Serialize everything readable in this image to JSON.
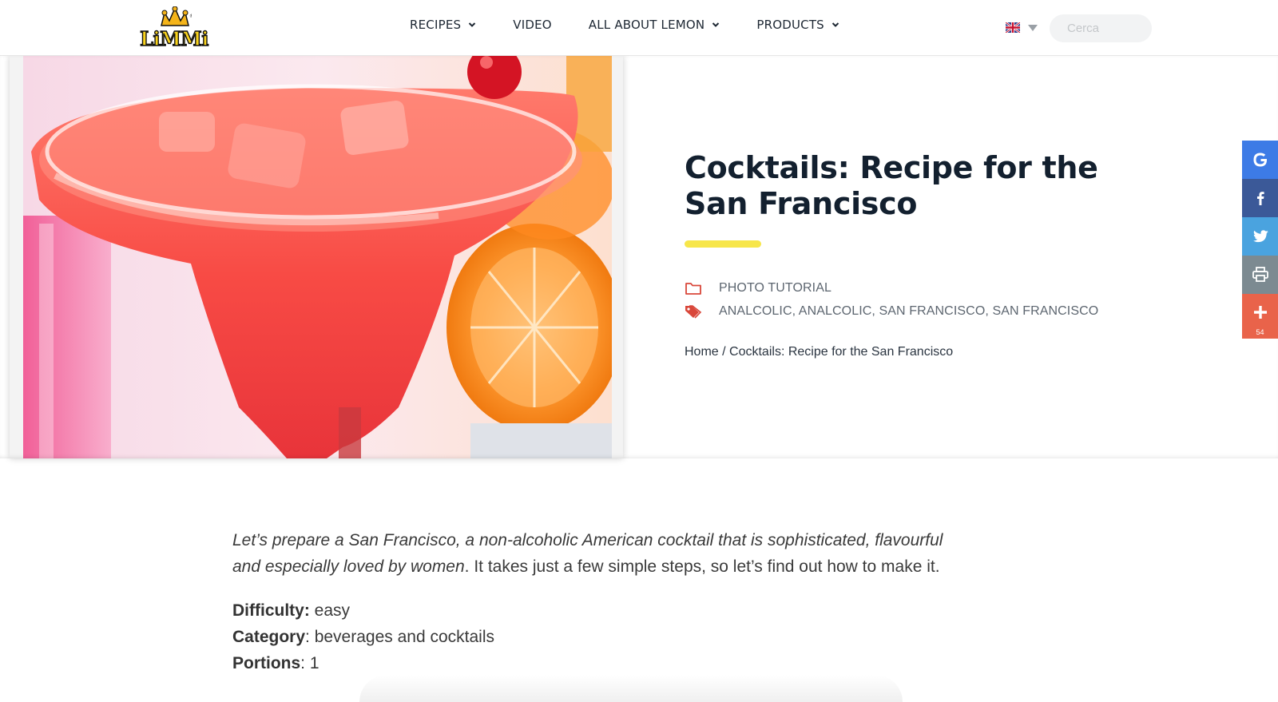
{
  "header": {
    "logo_text": "LiMMi",
    "nav": [
      {
        "label": "RECIPES",
        "has_dropdown": true
      },
      {
        "label": "VIDEO",
        "has_dropdown": false
      },
      {
        "label": "ALL ABOUT LEMON",
        "has_dropdown": true
      },
      {
        "label": "PRODUCTS",
        "has_dropdown": true
      }
    ],
    "language_flag": "uk-flag-icon",
    "search_placeholder": "Cerca"
  },
  "article": {
    "title": "Cocktails: Recipe for the San Francisco",
    "category": "PHOTO TUTORIAL",
    "tags": "ANALCOLIC, ANALCOLIC, SAN FRANCISCO, SAN FRANCISCO",
    "breadcrumb_home": "Home",
    "breadcrumb_separator": " / ",
    "breadcrumb_current": "Cocktails: Recipe for the San Francisco",
    "intro_italic": "Let’s prepare a San Francisco, a non-alcoholic American cocktail that is sophisticated, flavourful and especially loved by women",
    "intro_rest": ". It takes just a few simple steps, so let’s find out how to make it.",
    "facts": [
      {
        "label": "Difficulty:",
        "value": " easy"
      },
      {
        "label": "Category",
        "value": ": beverages and cocktails"
      },
      {
        "label": "Portions",
        "value": ": 1"
      }
    ]
  },
  "share": {
    "buttons": [
      {
        "name": "google-share-button",
        "icon": "google-icon",
        "color": "#3d7be6"
      },
      {
        "name": "facebook-share-button",
        "icon": "facebook-icon",
        "color": "#3b5998"
      },
      {
        "name": "twitter-share-button",
        "icon": "twitter-icon",
        "color": "#4aa3df"
      },
      {
        "name": "print-button",
        "icon": "print-icon",
        "color": "#7c8a91"
      },
      {
        "name": "more-share-button",
        "icon": "plus-icon",
        "color": "#e9634a"
      }
    ],
    "count": "54"
  },
  "colors": {
    "accent_yellow": "#f7e64a",
    "icon_red": "#d9473a",
    "title_dark": "#13202f"
  }
}
